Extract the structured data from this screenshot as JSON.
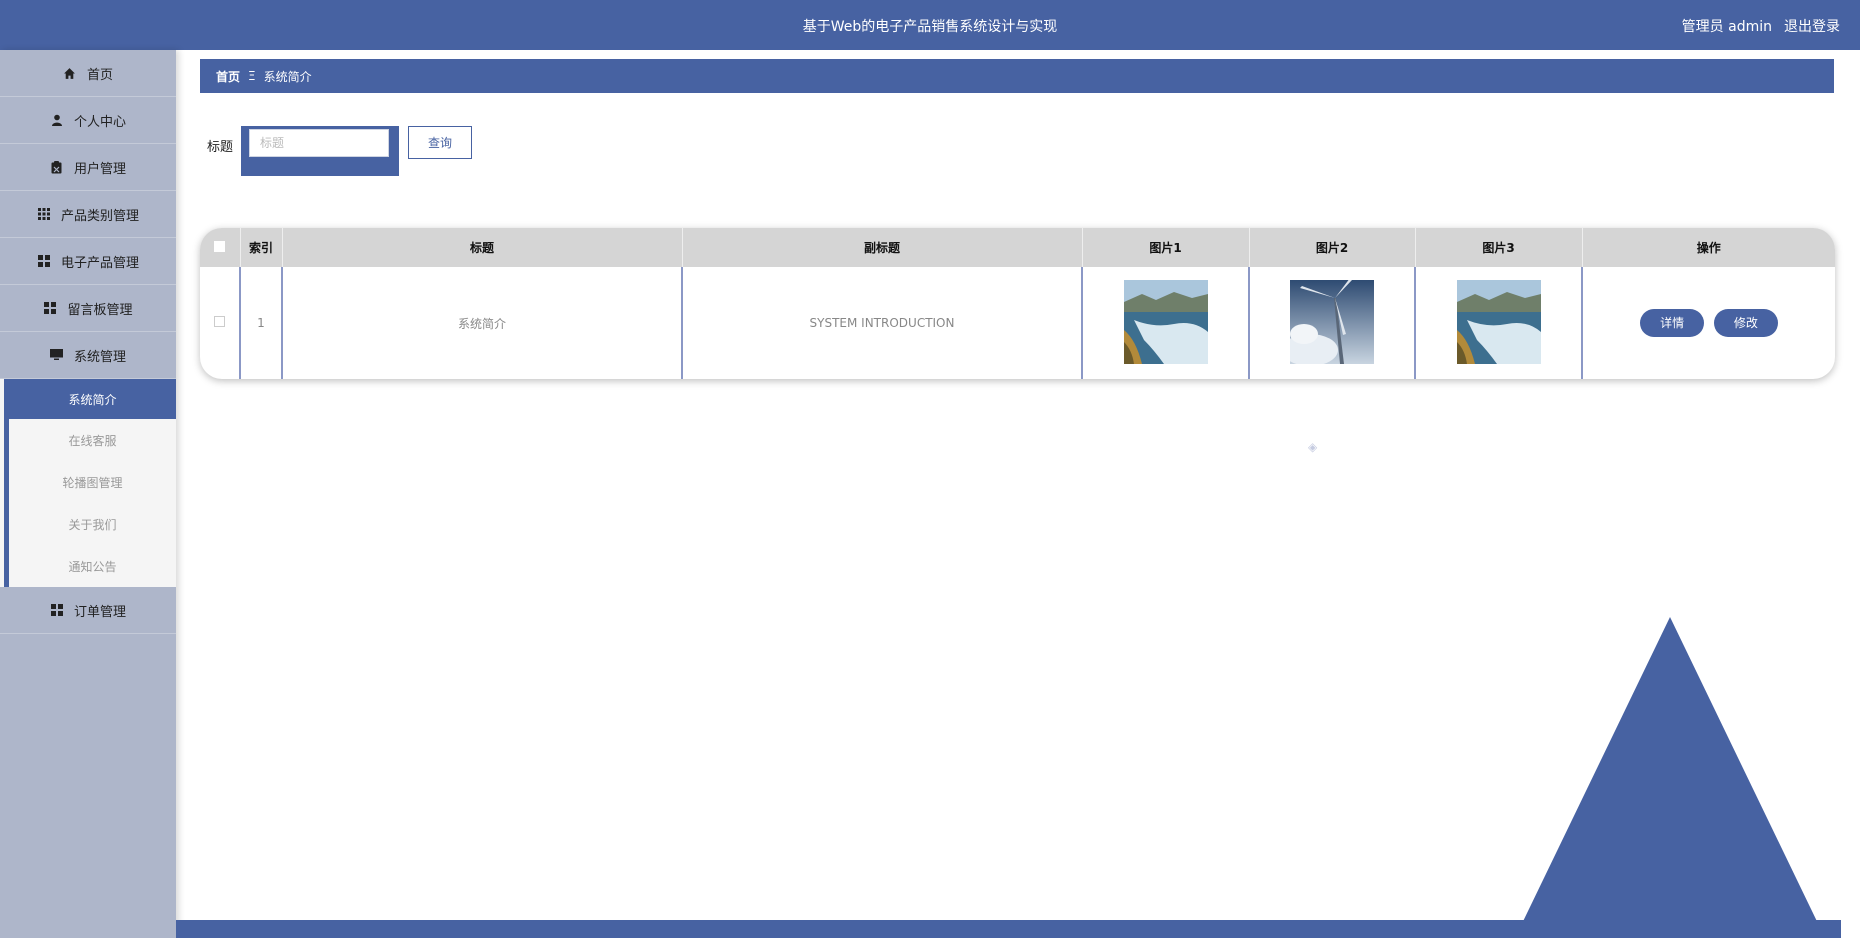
{
  "header": {
    "title": "基于Web的电子产品销售系统设计与实现",
    "user_label": "管理员 admin",
    "logout": "退出登录"
  },
  "sidebar": {
    "items": [
      {
        "label": "首页",
        "icon": "home-icon"
      },
      {
        "label": "个人中心",
        "icon": "user-icon"
      },
      {
        "label": "用户管理",
        "icon": "clipboard-icon"
      },
      {
        "label": "产品类别管理",
        "icon": "grid-icon"
      },
      {
        "label": "电子产品管理",
        "icon": "grid-icon"
      },
      {
        "label": "留言板管理",
        "icon": "grid-icon"
      },
      {
        "label": "系统管理",
        "icon": "monitor-icon"
      }
    ],
    "sub_items": [
      {
        "label": "系统简介",
        "active": true
      },
      {
        "label": "在线客服",
        "active": false
      },
      {
        "label": "轮播图管理",
        "active": false
      },
      {
        "label": "关于我们",
        "active": false
      },
      {
        "label": "通知公告",
        "active": false
      }
    ],
    "after_items": [
      {
        "label": "订单管理",
        "icon": "grid-icon"
      }
    ]
  },
  "breadcrumb": {
    "home": "首页",
    "separator": "Ξ",
    "current": "系统简介"
  },
  "search": {
    "label": "标题",
    "placeholder": "标题",
    "value": "",
    "button": "查询"
  },
  "table": {
    "columns": [
      "索引",
      "标题",
      "副标题",
      "图片1",
      "图片2",
      "图片3",
      "操作"
    ],
    "rows": [
      {
        "index": "1",
        "title": "系统简介",
        "subtitle": "SYSTEM INTRODUCTION",
        "images": [
          "coast-image",
          "wind-turbine-image",
          "coast-image"
        ],
        "actions": [
          "详情",
          "修改"
        ]
      }
    ]
  },
  "colors": {
    "primary": "#4762a2",
    "sidebar": "#aeb6ca",
    "table_header": "#d5d5d5"
  }
}
